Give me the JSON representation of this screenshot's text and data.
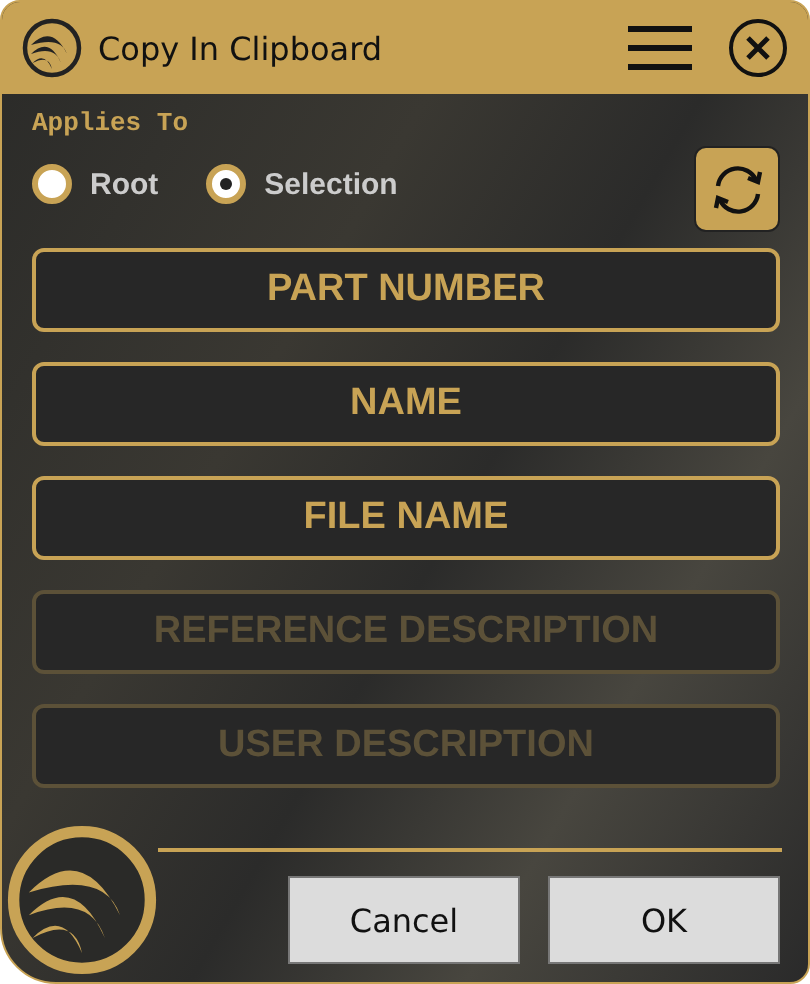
{
  "window": {
    "title": "Copy In Clipboard"
  },
  "applies_to": {
    "label": "Applies To",
    "options": [
      {
        "label": "Root",
        "selected": false
      },
      {
        "label": "Selection",
        "selected": true
      }
    ]
  },
  "fields": [
    {
      "label": "PART NUMBER",
      "disabled": false
    },
    {
      "label": "NAME",
      "disabled": false
    },
    {
      "label": "FILE NAME",
      "disabled": false
    },
    {
      "label": "REFERENCE DESCRIPTION",
      "disabled": true
    },
    {
      "label": "USER DESCRIPTION",
      "disabled": true
    }
  ],
  "buttons": [
    "Cancel",
    "OK"
  ]
}
